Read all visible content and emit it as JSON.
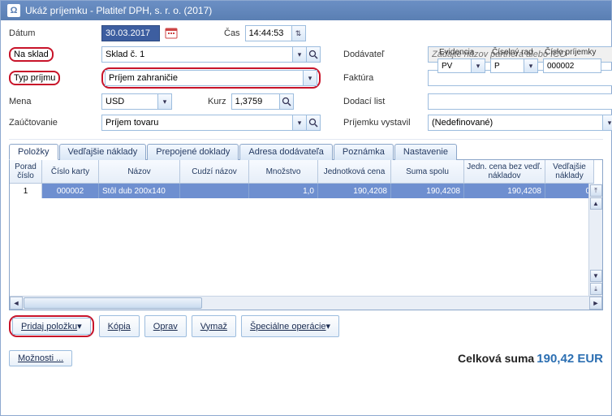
{
  "window_title": "Ukáž príjemku - Platiteľ DPH, s. r. o. (2017)",
  "labels": {
    "datum": "Dátum",
    "cas": "Čas",
    "na_sklad": "Na sklad",
    "typ_prijmu": "Typ príjmu",
    "mena": "Mena",
    "kurz": "Kurz",
    "zauctovanie": "Zaúčtovanie",
    "dodavatel": "Dodávateľ",
    "faktura": "Faktúra",
    "dodaci_list": "Dodací list",
    "prijemku_vystavil": "Príjemku vystavil"
  },
  "top_ids": {
    "evidencia_lbl": "Evidencia",
    "ciselny_rad_lbl": "Číselný rad",
    "cislo_prijemky_lbl": "Číslo príjemky",
    "evidencia": "PV",
    "ciselny_rad": "P",
    "cislo_prijemky": "000002"
  },
  "fields": {
    "datum": "30.03.2017",
    "cas": "14:44:53",
    "na_sklad": "Sklad č. 1",
    "typ_prijmu": "Príjem zahraničie",
    "mena": "USD",
    "kurz": "1,3759",
    "zauctovanie": "Príjem tovaru",
    "dodavatel_placeholder": "Zadajte názov partnera alebo IČO",
    "prijemku_vystavil": "(Nedefinované)"
  },
  "tabs": {
    "polozky": "Položky",
    "vedlajsie": "Vedľajšie náklady",
    "prepojene": "Prepojené doklady",
    "adresa": "Adresa dodávateľa",
    "poznamka": "Poznámka",
    "nastavenie": "Nastavenie"
  },
  "table": {
    "head": {
      "porad": "Porad číslo",
      "cislo_karty": "Číslo karty",
      "nazov": "Názov",
      "cudzi_nazov": "Cudzí názov",
      "mnozstvo": "Množstvo",
      "jedn_cena": "Jednotková cena",
      "suma_spolu": "Suma spolu",
      "jedn_bez": "Jedn. cena bez vedľ. nákladov",
      "vedl_nakl": "Vedľajšie náklady"
    },
    "row": {
      "porad": "1",
      "cislo_karty": "000002",
      "nazov": "Stôl dub 200x140",
      "cudzi_nazov": "",
      "mnozstvo": "1,0",
      "jedn_cena": "190,4208",
      "suma_spolu": "190,4208",
      "jedn_bez": "190,4208",
      "vedl_nakl": "0"
    }
  },
  "actions": {
    "pridaj": "Pridaj položku",
    "kopia": "Kópia",
    "oprav": "Oprav",
    "vymaz": "Vymaž",
    "spec": "Špeciálne operácie",
    "moznosti": "Možnosti ..."
  },
  "footer": {
    "label": "Celková suma",
    "value": "190,42 EUR"
  }
}
